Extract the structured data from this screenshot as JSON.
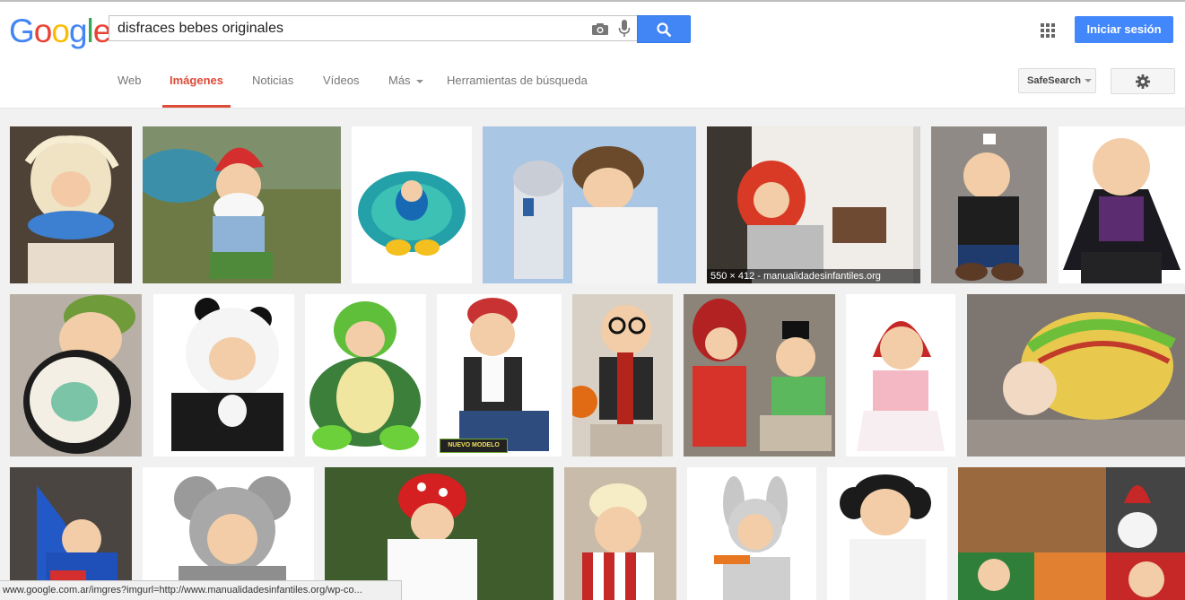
{
  "logo": {
    "text": "Google",
    "colors": [
      "#4285f4",
      "#ea4335",
      "#fbbc05",
      "#4285f4",
      "#34a853",
      "#ea4335"
    ]
  },
  "search": {
    "query": "disfraces bebes originales"
  },
  "header": {
    "signin_label": "Iniciar sesión"
  },
  "nav": {
    "tabs": [
      {
        "label": "Web",
        "active": false
      },
      {
        "label": "Imágenes",
        "active": true
      },
      {
        "label": "Noticias",
        "active": false
      },
      {
        "label": "Vídeos",
        "active": false
      },
      {
        "label": "Más",
        "active": false
      },
      {
        "label": "Herramientas de búsqueda",
        "active": false
      }
    ],
    "safesearch_label": "SafeSearch"
  },
  "results": {
    "hover_meta": "550 × 412 - manualidadesinfantiles.org",
    "badge": "NUEVO MODELO"
  },
  "status_bar": {
    "url": "www.google.com.ar/imgres?imgurl=http://www.manualidadesinfantiles.org/wp-co..."
  },
  "colors": {
    "accent_red": "#dd4b39",
    "button_blue": "#4387fd",
    "results_bg": "#f1f1f1"
  }
}
